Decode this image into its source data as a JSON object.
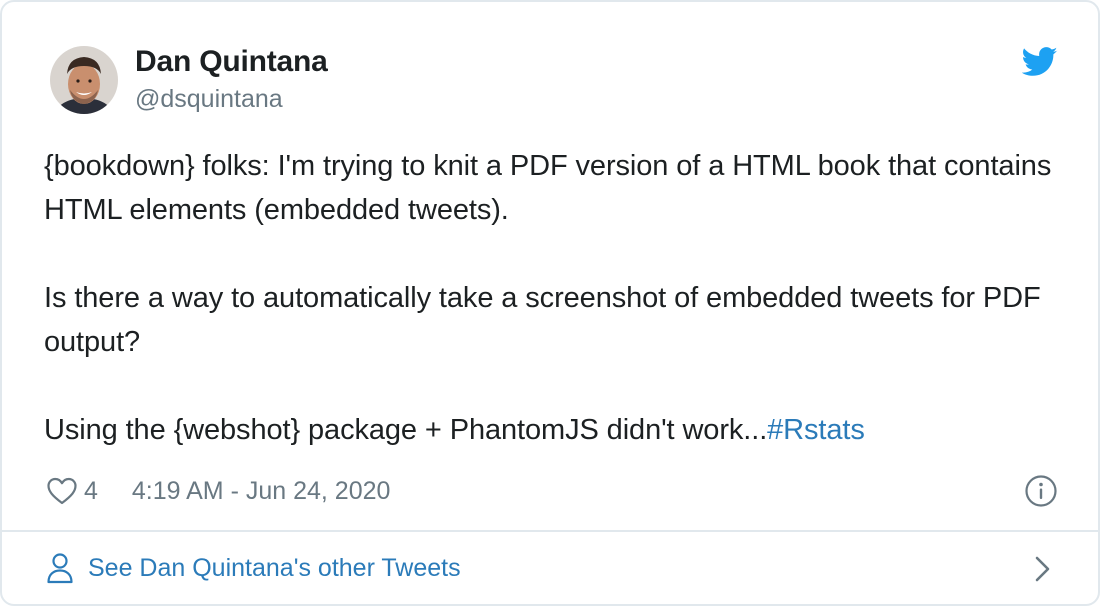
{
  "author": {
    "name": "Dan Quintana",
    "handle": "@dsquintana"
  },
  "tweet": {
    "paragraph_1": "{bookdown} folks: I'm trying to knit a PDF version of a HTML book that contains HTML elements (embedded tweets).",
    "paragraph_2": "Is there a way to automatically take a screenshot of embedded tweets for PDF output?",
    "paragraph_3_text": "Using the {webshot} package + PhantomJS didn't work...",
    "hashtag": "#Rstats"
  },
  "meta": {
    "like_count": "4",
    "timestamp": "4:19 AM - Jun 24, 2020"
  },
  "footer": {
    "link_label": "See Dan Quintana's other Tweets"
  },
  "icons": {
    "bird": "twitter-bird-icon",
    "heart": "heart-icon",
    "info": "info-icon",
    "person": "person-icon",
    "chevron": "chevron-right-icon"
  },
  "colors": {
    "twitter_blue": "#1da1f2",
    "link_blue": "#2b7bb9",
    "text": "#1c2022",
    "muted": "#697882",
    "border": "#e1e8ed"
  }
}
